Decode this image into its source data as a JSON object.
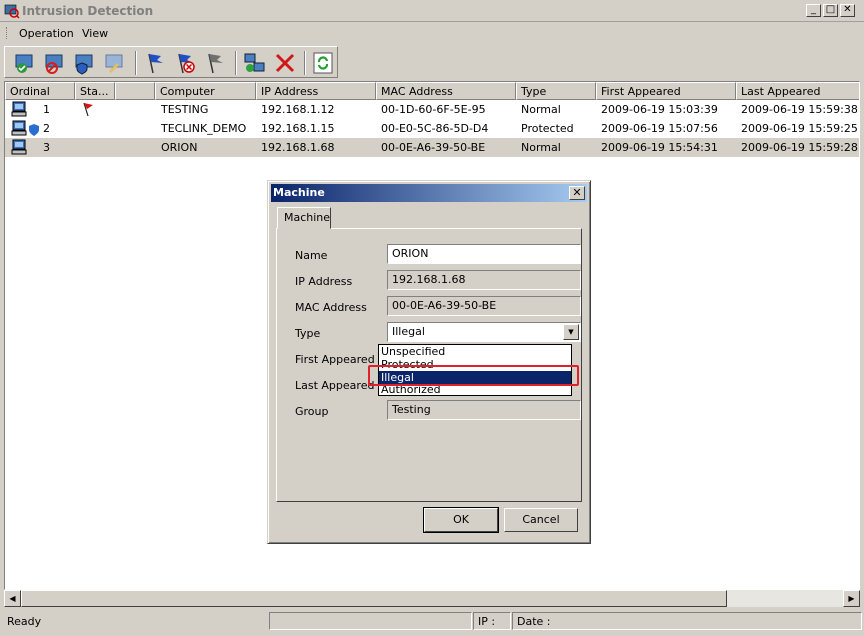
{
  "window": {
    "title": "Intrusion Detection"
  },
  "menu": {
    "operation": "Operation",
    "view": "View"
  },
  "toolbar": {
    "buttons": [
      "approve-machine-icon",
      "block-machine-icon",
      "protect-machine-icon",
      "edit-machine-icon",
      "flag-blue-icon",
      "flag-remove-icon",
      "flag-gray-icon",
      "network-scan-icon",
      "delete-icon",
      "refresh-icon"
    ]
  },
  "list": {
    "columns": [
      "Ordinal",
      "Sta...",
      "",
      "Computer",
      "IP Address",
      "MAC Address",
      "Type",
      "First Appeared",
      "Last Appeared"
    ],
    "rows": [
      {
        "ordinal": "1",
        "computer": "TESTING",
        "ip": "192.168.1.12",
        "mac": "00-1D-60-6F-5E-95",
        "type": "Normal",
        "first": "2009-06-19 15:03:39",
        "last": "2009-06-19 15:59:38"
      },
      {
        "ordinal": "2",
        "computer": "TECLINK_DEMO",
        "ip": "192.168.1.15",
        "mac": "00-E0-5C-86-5D-D4",
        "type": "Protected",
        "first": "2009-06-19 15:07:56",
        "last": "2009-06-19 15:59:25"
      },
      {
        "ordinal": "3",
        "computer": "ORION",
        "ip": "192.168.1.68",
        "mac": "00-0E-A6-39-50-BE",
        "type": "Normal",
        "first": "2009-06-19 15:54:31",
        "last": "2009-06-19 15:59:28"
      }
    ]
  },
  "status": {
    "ready": "Ready",
    "ip": "IP :",
    "date": "Date :"
  },
  "dialog": {
    "title": "Machine",
    "tab": "Machine",
    "labels": {
      "name": "Name",
      "ip": "IP Address",
      "mac": "MAC Address",
      "type": "Type",
      "first": "First Appeared",
      "last": "Last Appeared",
      "group": "Group"
    },
    "values": {
      "name": "ORION",
      "ip": "192.168.1.68",
      "mac": "00-0E-A6-39-50-BE",
      "type": "Illegal",
      "group": "Testing"
    },
    "type_options": [
      "Unspecified",
      "Protected",
      "Illegal",
      "Authorized"
    ],
    "ok": "OK",
    "cancel": "Cancel"
  }
}
